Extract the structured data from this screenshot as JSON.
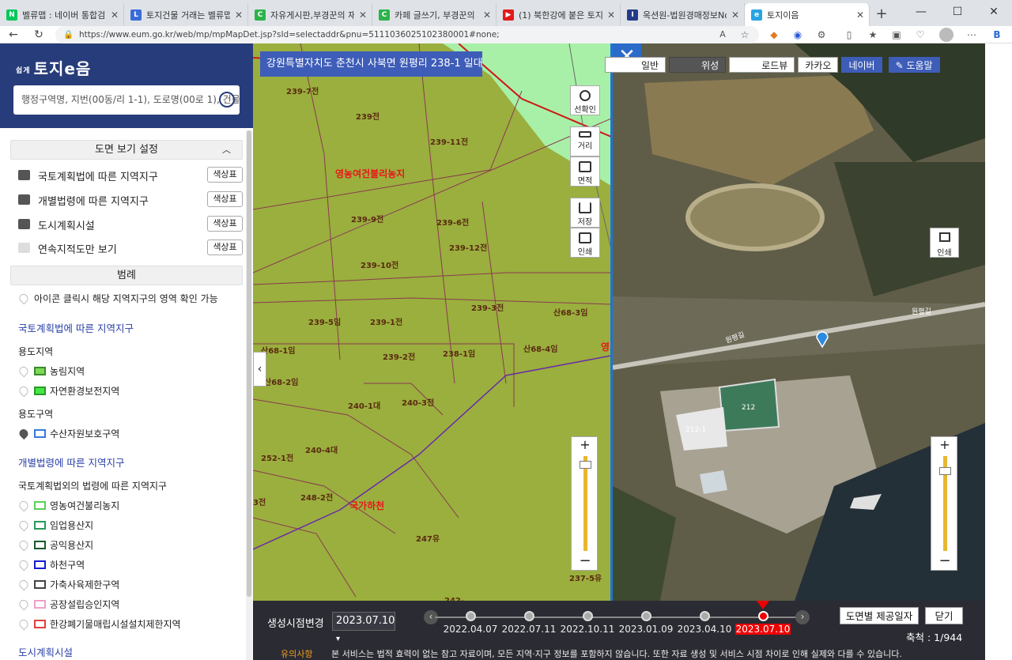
{
  "browser": {
    "tabs": [
      {
        "title": "벨류맵 : 네이버 통합검색",
        "icon": "naver",
        "color": "#03c75a",
        "glyph": "N"
      },
      {
        "title": "토지건물 거래는 벨류맵",
        "icon": "valuemap",
        "color": "#3a6bd8",
        "glyph": "L"
      },
      {
        "title": "자유게시판,부경꾼의 재테크 인",
        "icon": "cafe",
        "color": "#2cb34a",
        "glyph": "C"
      },
      {
        "title": "카페 글쓰기, 부경꾼의 재테크",
        "icon": "cafe",
        "color": "#2cb34a",
        "glyph": "C"
      },
      {
        "title": "(1) 북한강에 붙은 토지가 1,200",
        "icon": "youtube",
        "color": "#e21a1a",
        "glyph": "▶"
      },
      {
        "title": "옥션원-법원경매정보No.1",
        "icon": "auction",
        "color": "#233b88",
        "glyph": "I"
      },
      {
        "title": "토지이음",
        "icon": "eum",
        "color": "#27a4e3",
        "glyph": "e"
      }
    ],
    "new_tab": "+",
    "url": "https://www.eum.go.kr/web/mp/mpMapDet.jsp?sId=selectaddr&pnu=5111036025102380001#none;",
    "read_aloud": "A",
    "profile": "B"
  },
  "sidebar": {
    "logo": "토지e음",
    "logo_small": "쉽게",
    "search_placeholder": "행정구역명, 지번(00동/리 1-1), 도로명(00로 1), 건물명",
    "view_settings_title": "도면 보기 설정",
    "layers": [
      {
        "label": "국토계획법에 따른 지역지구",
        "visible": true,
        "button": "색상표"
      },
      {
        "label": "개별법령에 따른 지역지구",
        "visible": true,
        "button": "색상표"
      },
      {
        "label": "도시계획시설",
        "visible": true,
        "button": "색상표"
      },
      {
        "label": "연속지적도만 보기",
        "visible": false,
        "button": "색상표"
      }
    ],
    "legend_title": "범례",
    "legend_hint": "아이콘 클릭시 해당 지역지구의 영역 확인 가능",
    "group1_title": "국토계획법에 따른 지역지구",
    "sub_youdo": "용도지역",
    "youdo_items": [
      {
        "label": "농림지역",
        "color": "#7ed957",
        "filled": true
      },
      {
        "label": "자연환경보전지역",
        "color": "#44e844",
        "filled": true
      }
    ],
    "sub_youdogu": "용도구역",
    "youdogu_items": [
      {
        "label": "수산자원보호구역",
        "color": "#3a7ad8",
        "filled": false
      }
    ],
    "group2_title": "개별법령에 따른 지역지구",
    "sub_other": "국토계획법외의 법령에 따른 지역지구",
    "other_items": [
      {
        "label": "영농여건불리농지",
        "color": "#5ad05a"
      },
      {
        "label": "임업용산지",
        "color": "#2a9a5a"
      },
      {
        "label": "공익용산지",
        "color": "#1a5a2a"
      },
      {
        "label": "하천구역",
        "color": "#1a1ad0"
      },
      {
        "label": "가축사육제한구역",
        "color": "#444444"
      },
      {
        "label": "공장설립승인지역",
        "color": "#f0a0c8"
      },
      {
        "label": "한강폐기물매립시설설치제한지역",
        "color": "#e04040"
      }
    ],
    "cut_off_text": "도시계획시설"
  },
  "map": {
    "address": "강원특별자치도 춘천시 사북면 원평리 238-1 일대",
    "tools": {
      "zoom_confirm": "선확인",
      "distance": "거리",
      "area": "면적",
      "save": "저장",
      "print": "인쇄"
    },
    "zoom_plus": "+",
    "zoom_minus": "−",
    "zoom_level_fraction": 0.95,
    "map_types": [
      "일반",
      "위성",
      "로드뷰",
      "카카오",
      "네이버"
    ],
    "help": "도움말",
    "right_print": "인쇄",
    "close": "✕",
    "collapse": "‹",
    "parcels": [
      "239-7전",
      "239전",
      "239-11전",
      "239-9전",
      "239-6전",
      "239-12전",
      "239-10전",
      "239-3전",
      "산68-3임",
      "239-5임",
      "239-1전",
      "238-1임",
      "산68-4임",
      "산68-1임",
      "239-2전",
      "산68-2임",
      "240-1대",
      "240-3전",
      "240-4대",
      "252-1전",
      "248-2전",
      "3전",
      "247유",
      "237-5유",
      "242-"
    ],
    "zones": [
      "영농여건불리농지",
      "국가하천",
      "영"
    ],
    "right_labels": [
      "원평길",
      "원평길",
      "212",
      "212-1"
    ]
  },
  "timeline": {
    "label": "생성시점변경",
    "selected": "2023.07.10",
    "dates": [
      "2022.04.07",
      "2022.07.11",
      "2022.10.11",
      "2023.01.09",
      "2023.04.10",
      "2023.07.10"
    ],
    "prev": "‹",
    "next": "›",
    "provide_button": "도면별 제공일자",
    "close_button": "닫기",
    "scale": "축척 : 1/944"
  },
  "notice": {
    "title": "유의사항",
    "text": "본 서비스는 법적 효력이 없는 참고 자료이며, 모든 지역·지구 정보를 포함하지 않습니다. 또한 자료 생성 및 서비스 시점 차이로 인해 실제와 다를 수 있습니다."
  }
}
